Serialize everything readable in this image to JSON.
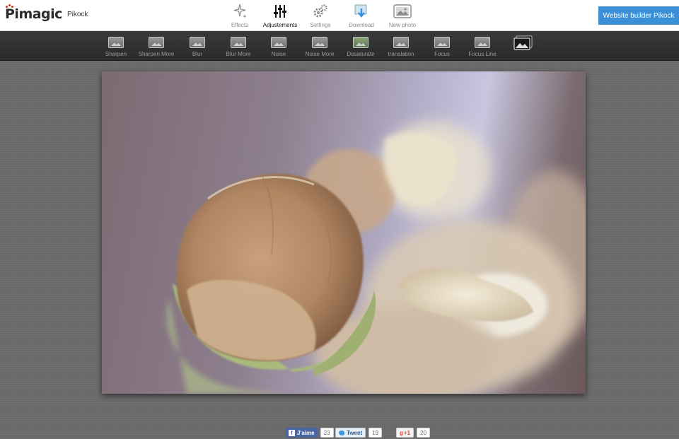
{
  "app": {
    "logo_text": "Pimagic",
    "logo_sub": "Pikock"
  },
  "topnav": {
    "items": [
      {
        "label": "Effects",
        "icon": "sparkle-icon",
        "active": false
      },
      {
        "label": "Adjustements",
        "icon": "sliders-icon",
        "active": true
      },
      {
        "label": "Settings",
        "icon": "gears-icon",
        "active": false
      },
      {
        "label": "Download",
        "icon": "download-icon",
        "active": false
      },
      {
        "label": "New photo",
        "icon": "photo-icon",
        "active": false
      }
    ]
  },
  "cta": {
    "label": "Website builder Pikock",
    "color": "#3a8fd6"
  },
  "toolbar": {
    "tools": [
      {
        "label": "Sharpen"
      },
      {
        "label": "Sharpen More"
      },
      {
        "label": "Blur"
      },
      {
        "label": "Blur More"
      },
      {
        "label": "Noise"
      },
      {
        "label": "Noise More"
      },
      {
        "label": "Desaturate"
      },
      {
        "label": "translation"
      },
      {
        "label": "Focus"
      },
      {
        "label": "Focus Line"
      }
    ],
    "gallery_icon": "photo-stack-icon"
  },
  "social": {
    "facebook": {
      "label": "J'aime",
      "count": "23"
    },
    "twitter": {
      "label": "Tweet",
      "count": "19"
    },
    "gplus": {
      "label": "+1",
      "count": "20"
    }
  }
}
